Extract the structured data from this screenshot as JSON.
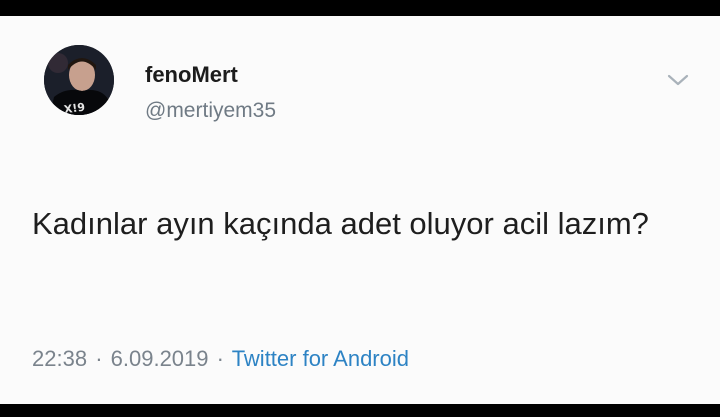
{
  "tweet": {
    "author": {
      "display_name": "fenoMert",
      "handle": "@mertiyem35",
      "avatar_shirt_text": "X!9"
    },
    "text": "Kadınlar ayın kaçında adet oluyor acil lazım?",
    "time": "22:38",
    "separator": "·",
    "date": "6.09.2019",
    "source": "Twitter for Android"
  },
  "icons": {
    "menu": "chevron-down-icon"
  },
  "colors": {
    "background": "#fbfbfb",
    "name": "#1c1c1c",
    "muted": "#6f7a84",
    "link": "#2d83c4"
  }
}
